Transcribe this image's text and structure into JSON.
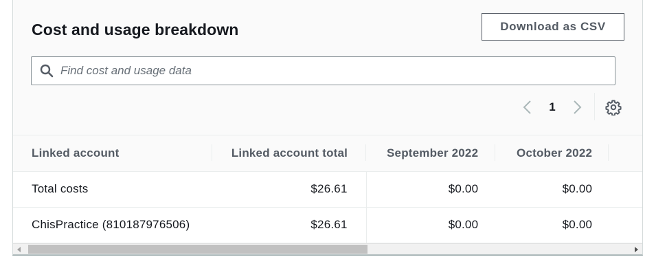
{
  "panel": {
    "title": "Cost and usage breakdown",
    "download_label": "Download as CSV"
  },
  "search": {
    "placeholder": "Find cost and usage data",
    "value": "",
    "icon": "search-icon"
  },
  "pagination": {
    "current_page": "1",
    "prev_icon": "chevron-left-icon",
    "next_icon": "chevron-right-icon",
    "settings_icon": "gear-icon"
  },
  "table": {
    "columns": [
      "Linked account",
      "Linked account total",
      "September 2022",
      "October 2022"
    ],
    "rows": [
      [
        "Total costs",
        "$26.61",
        "$0.00",
        "$0.00"
      ],
      [
        "ChisPractice (810187976506)",
        "$26.61",
        "$0.00",
        "$0.00"
      ]
    ]
  },
  "scrollbar": {
    "horizontal_position": 0.0
  },
  "colors": {
    "text": "#16191f",
    "secondary_text": "#545b64",
    "border": "#879196",
    "panel_bg": "#fafafa",
    "divider": "#eaeded"
  }
}
